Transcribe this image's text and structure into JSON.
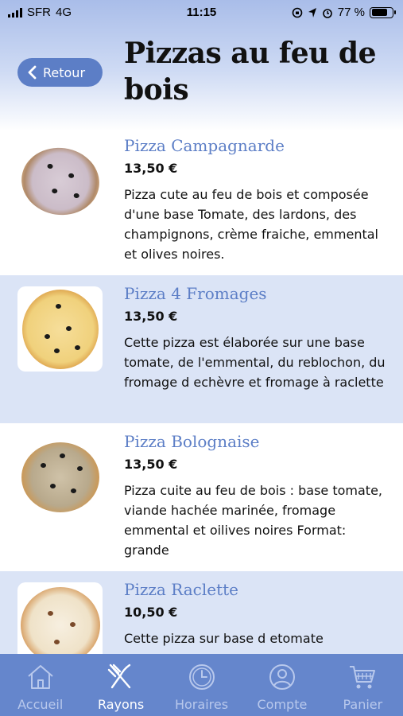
{
  "status_bar": {
    "carrier": "SFR",
    "network": "4G",
    "time": "11:15",
    "battery": "77 %",
    "battery_level": 0.77
  },
  "header": {
    "back_label": "Retour",
    "title": "Pizzas au feu de bois"
  },
  "products": [
    {
      "name": "Pizza Campagnarde",
      "price": "13,50 €",
      "description": "Pizza cute au feu de bois et composée d'une base Tomate, des lardons, des champignons, crème fraiche, emmental et olives noires."
    },
    {
      "name": "Pizza 4 Fromages",
      "price": "13,50 €",
      "description": "Cette pizza est élaborée sur une base tomate, de l'emmental, du reblochon, du fromage d echèvre et fromage à raclette"
    },
    {
      "name": "Pizza Bolognaise",
      "price": "13,50 €",
      "description": "Pizza cuite au feu de bois : base tomate, viande hachée marinée, fromage emmental et oilives noires Format: grande"
    },
    {
      "name": "Pizza Raclette",
      "price": "10,50 €",
      "description": "Cette pizza sur base d etomate"
    }
  ],
  "tabbar": {
    "tabs": [
      {
        "label": "Accueil",
        "icon": "home-icon"
      },
      {
        "label": "Rayons",
        "icon": "fork-knife-icon"
      },
      {
        "label": "Horaires",
        "icon": "clock-icon"
      },
      {
        "label": "Compte",
        "icon": "user-icon"
      },
      {
        "label": "Panier",
        "icon": "cart-icon"
      }
    ],
    "active": "Rayons"
  },
  "colors": {
    "accent": "#5c7ec6",
    "tabbar": "#6586cc",
    "row_alt": "#dbe4f6"
  }
}
